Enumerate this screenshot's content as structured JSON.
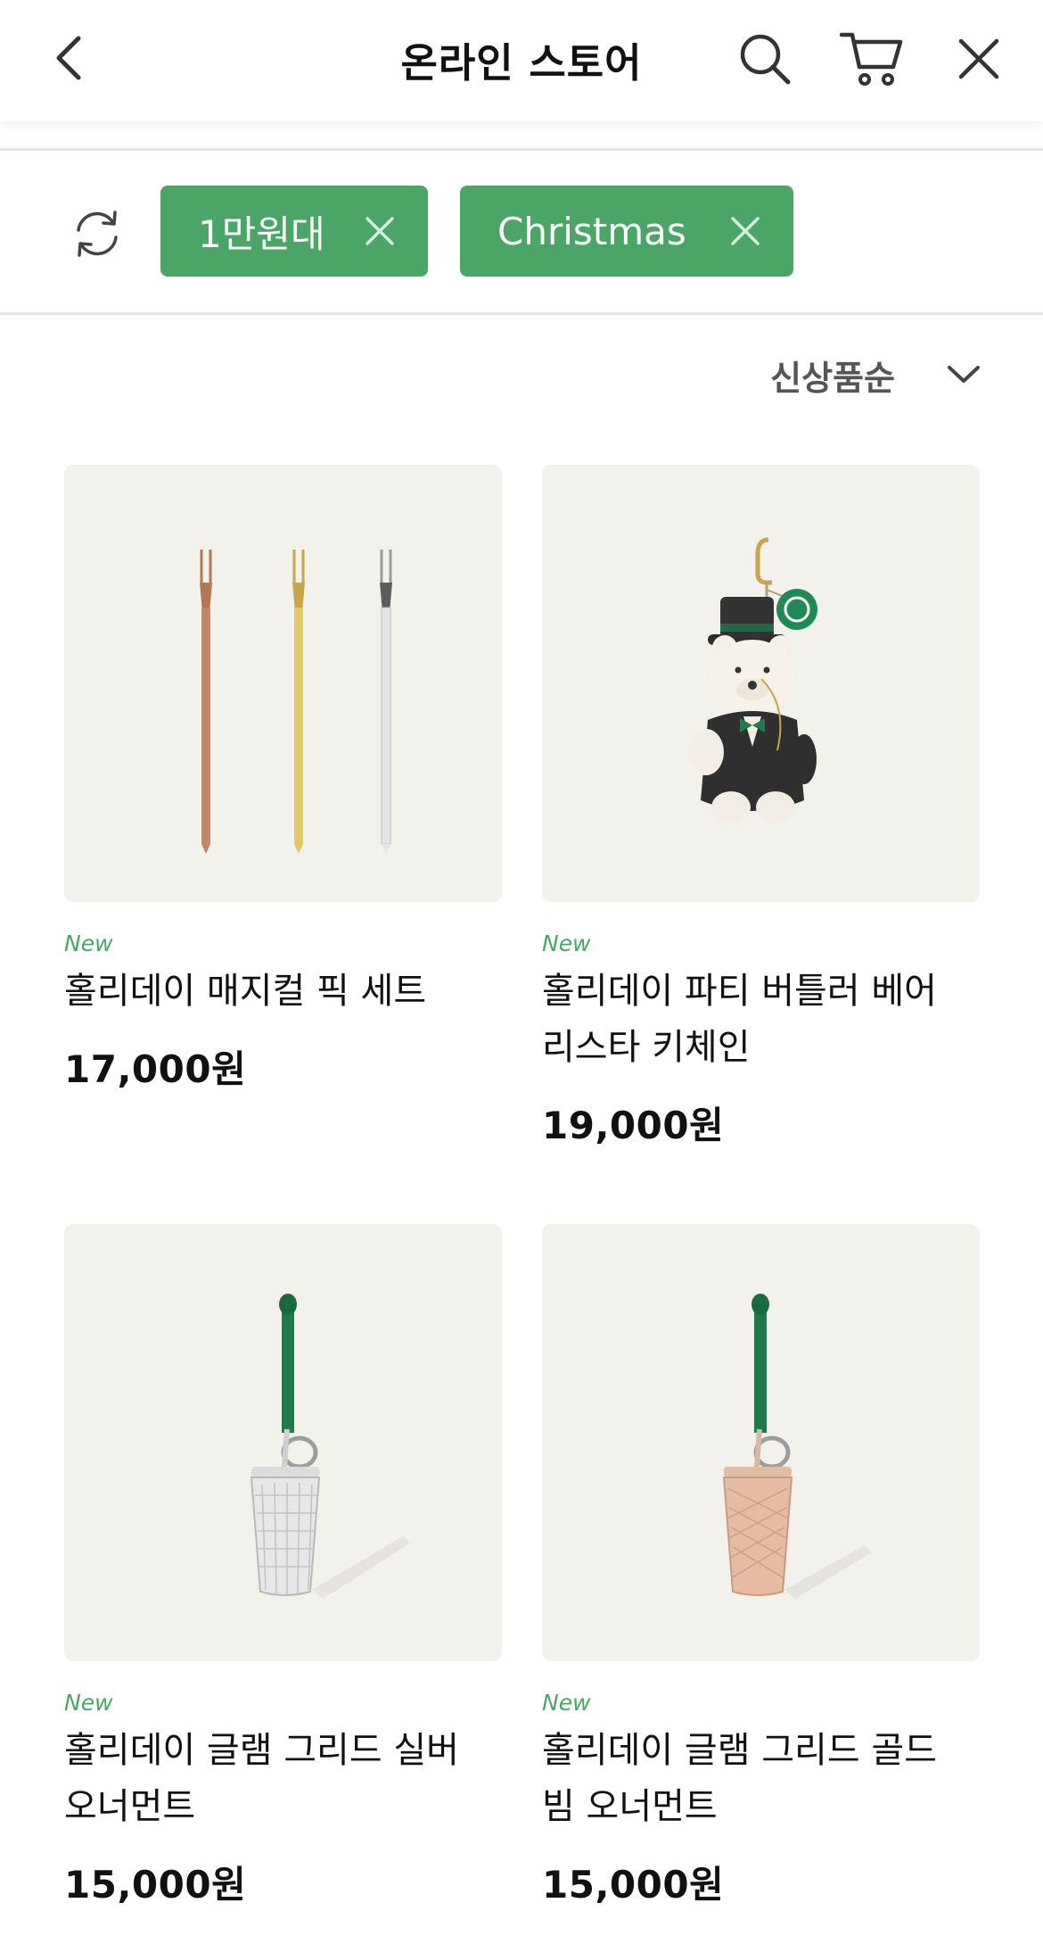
{
  "header": {
    "title": "온라인 스토어"
  },
  "filters": {
    "chips": [
      {
        "label": "1만원대"
      },
      {
        "label": "Christmas"
      }
    ]
  },
  "sort": {
    "label": "신상품순"
  },
  "products": [
    {
      "tag": "New",
      "name": "홀리데이 매지컬 픽 세트",
      "price": "17,000원"
    },
    {
      "tag": "New",
      "name": "홀리데이 파티 버틀러 베어 리스타 키체인",
      "price": "19,000원"
    },
    {
      "tag": "New",
      "name": "홀리데이 글램 그리드 실버 오너먼트",
      "price": "15,000원"
    },
    {
      "tag": "New",
      "name": "홀리데이 글램 그리드 골드 빔 오너먼트",
      "price": "15,000원"
    }
  ],
  "colors": {
    "accent_green": "#4aa566",
    "thumb_bg": "#f3f1ec"
  },
  "icons": [
    "back-icon",
    "search-icon",
    "cart-icon",
    "close-icon",
    "refresh-icon",
    "chip-remove-icon",
    "chevron-down-icon"
  ]
}
